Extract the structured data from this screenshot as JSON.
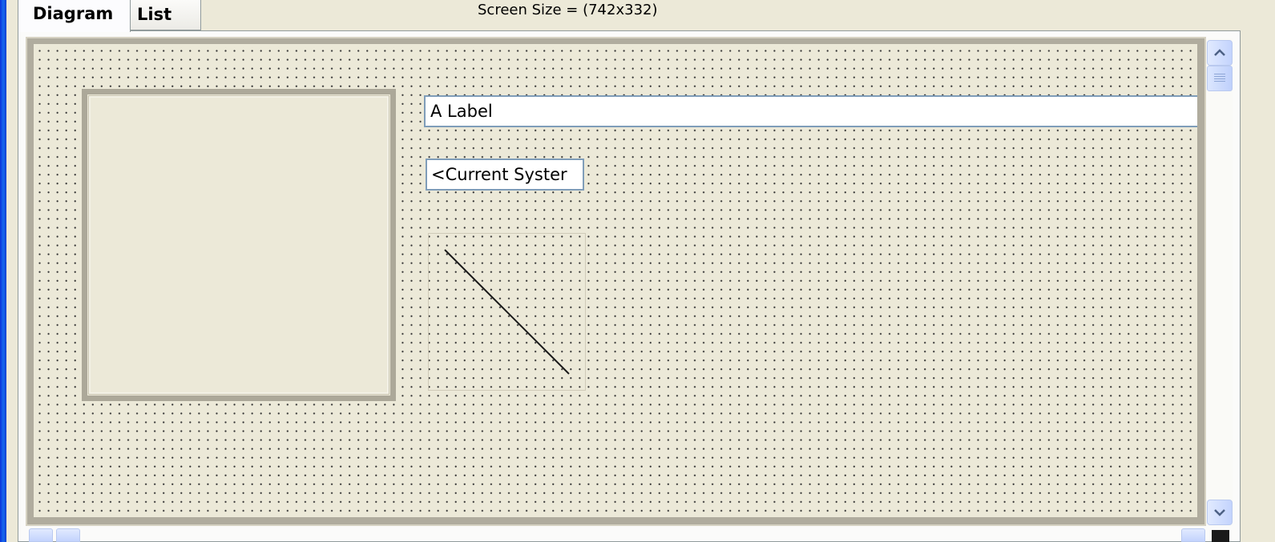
{
  "tabs": [
    {
      "label": "Diagram",
      "active": true
    },
    {
      "label": "List",
      "active": false
    }
  ],
  "header": {
    "screen_size_text": "Screen Size = (742x332)"
  },
  "canvas": {
    "grid": true,
    "widgets": {
      "label_text": "A Label",
      "text_value": "<Current Syster"
    }
  },
  "scrollbar": {
    "up_icon": "arrow-up",
    "down_icon": "arrow-down"
  },
  "colors": {
    "canvas_bg": "#ece9d8",
    "frame_border": "#aca899",
    "field_border": "#7f9db9",
    "scrollbar_accent": "#c3d3fd"
  }
}
